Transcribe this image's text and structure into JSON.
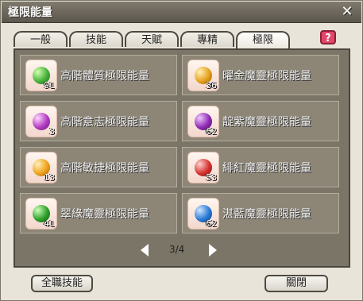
{
  "window": {
    "title": "極限能量",
    "close_glyph": "✕"
  },
  "tabs": [
    {
      "label": "一般",
      "active": false
    },
    {
      "label": "技能",
      "active": false
    },
    {
      "label": "天賦",
      "active": false
    },
    {
      "label": "專精",
      "active": false
    },
    {
      "label": "極限",
      "active": true
    }
  ],
  "help": {
    "label": "?"
  },
  "items": [
    {
      "name": "高階體質極限能量",
      "count": "91",
      "color": "#46b23c",
      "icon": "green-energy-orb-icon"
    },
    {
      "name": "曜金魔靈極限能量",
      "count": "36",
      "color": "#e6a11d",
      "icon": "gold-energy-orb-icon"
    },
    {
      "name": "高階意志極限能量",
      "count": "3",
      "color": "#b33bc2",
      "icon": "purple-energy-orb-icon"
    },
    {
      "name": "靛紫魔靈極限能量",
      "count": "62",
      "color": "#8f2bb3",
      "icon": "violet-energy-orb-icon"
    },
    {
      "name": "高階敏捷極限能量",
      "count": "13",
      "color": "#f0a31b",
      "icon": "orange-energy-orb-icon"
    },
    {
      "name": "緋紅魔靈極限能量",
      "count": "53",
      "color": "#d5312f",
      "icon": "red-energy-orb-icon"
    },
    {
      "name": "翠綠魔靈極限能量",
      "count": "41",
      "color": "#2f9f2b",
      "icon": "green-energy-orb-icon"
    },
    {
      "name": "湛藍魔靈極限能量",
      "count": "62",
      "color": "#2b79d5",
      "icon": "blue-energy-orb-icon"
    }
  ],
  "pager": {
    "label": "3/4"
  },
  "buttons": {
    "all_skills": "全職技能",
    "close": "關閉"
  }
}
